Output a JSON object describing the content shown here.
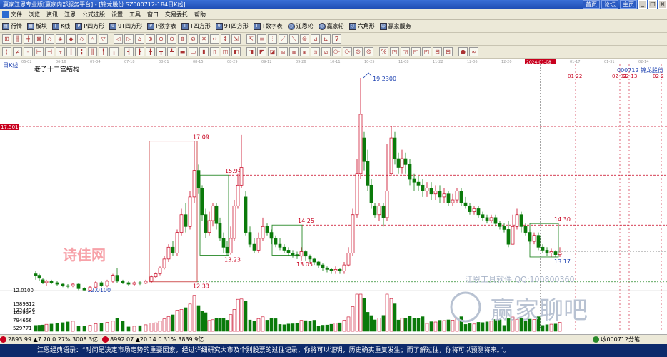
{
  "window": {
    "title": "赢家江恩专业版[赢家内部服务平台] - [锦龙股份   SZ000712-184日K线]",
    "buttons": [
      "首页",
      "论坛",
      "主页"
    ]
  },
  "menu": [
    "文件",
    "浏览",
    "资讯",
    "江恩",
    "公式选股",
    "设置",
    "工具",
    "窗口",
    "交易委托",
    "帮助"
  ],
  "toolbar": [
    "行情",
    "板块",
    "K线",
    "P四方形",
    "9T四方形",
    "P数字表",
    "T四方形",
    "9T四方形",
    "T数字表",
    "江恩轮",
    "赢家轮",
    "六角形",
    "赢家服务"
  ],
  "chart": {
    "period_label": "日K线",
    "structure_title": "老子十二宫结构",
    "stock_code": "000712",
    "stock_name": "锦龙股份",
    "price_left_marker": "17.5017",
    "price_low_axis": "12.0100",
    "peak_label": "19.2300",
    "low_label": "12.0100",
    "box_labels": [
      "17.09",
      "12.33",
      "15.94",
      "13.23",
      "14.25",
      "13.05",
      "14.30",
      "13.17"
    ],
    "cursor_date": "2024-01-08",
    "future_dates": [
      "01-22",
      "02-02",
      "02-13",
      "02-2"
    ],
    "date_ticks": [
      "06-02",
      "06-16",
      "07-04",
      "07-18",
      "08-01",
      "08-15",
      "08-29",
      "09-12",
      "09-26",
      "10-11",
      "10-25",
      "11-08",
      "11-22",
      "12-06",
      "12-20",
      "01-03",
      "01-17",
      "01-31",
      "02-14"
    ],
    "volume_labels": [
      "1589312",
      "1324426",
      "1059541",
      "794656",
      "529771"
    ],
    "watermark_left": "诗佳网",
    "watermark_right_line1": "江恩工具软件 QQ:100800360",
    "watermark_right_line2": "赢家聊吧",
    "accent_box": "#2a8a2a",
    "accent_line": "#c8001e"
  },
  "status": {
    "index1": "2893.99 ▲7.70 0.27% 3008.3亿",
    "index2": "8992.07 ▲20.14 0.31% 3839.9亿",
    "right": "收000712分笔"
  },
  "quote": "江恩经典语录：“时间是决定市场走势的重要因素，经过详细研究大市及个别股票的过往记录，你将可以证明，历史确实重复发生；而了解过往，你将可以预测将来。”。"
}
